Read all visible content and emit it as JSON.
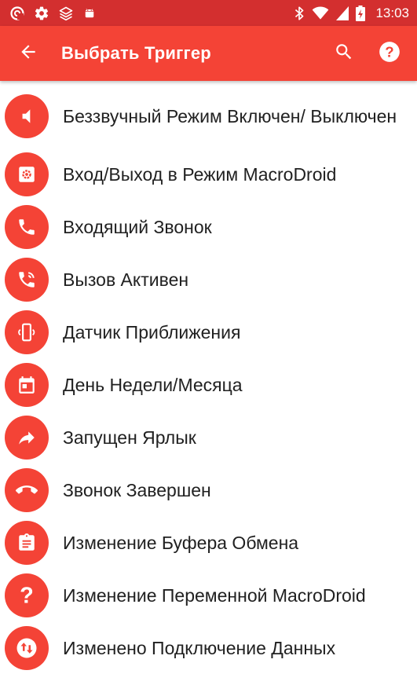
{
  "status_bar": {
    "time": "13:03",
    "left_icons": [
      "macrodroid-icon",
      "settings-icon",
      "layers-icon",
      "android-icon"
    ],
    "right_icons": [
      "bluetooth-icon",
      "wifi-icon",
      "signal-icon",
      "battery-charging-icon"
    ]
  },
  "app_bar": {
    "title": "Выбрать Триггер",
    "back_icon": "arrow-back-icon",
    "actions": [
      "search-icon",
      "help-icon"
    ]
  },
  "colors": {
    "status_bar": "#d32f2f",
    "app_bar": "#f44336",
    "icon_circle": "#f44336",
    "text": "#212121"
  },
  "triggers": [
    {
      "label": "Беззвучный Режим Включен/ Выключен",
      "icon": "volume-icon"
    },
    {
      "label": "Вход/Выход в Режим MacroDroid",
      "icon": "settings-box-icon"
    },
    {
      "label": "Входящий Звонок",
      "icon": "phone-icon"
    },
    {
      "label": "Вызов Активен",
      "icon": "phone-in-talk-icon"
    },
    {
      "label": "Датчик Приближения",
      "icon": "proximity-icon"
    },
    {
      "label": "День Недели/Месяца",
      "icon": "calendar-icon"
    },
    {
      "label": "Запущен Ярлык",
      "icon": "shortcut-icon"
    },
    {
      "label": "Звонок Завершен",
      "icon": "call-end-icon"
    },
    {
      "label": "Изменение Буфера Обмена",
      "icon": "clipboard-icon"
    },
    {
      "label": "Изменение Переменной MacroDroid",
      "icon": "question-icon"
    },
    {
      "label": "Изменено Подключение Данных",
      "icon": "data-swap-icon"
    }
  ]
}
